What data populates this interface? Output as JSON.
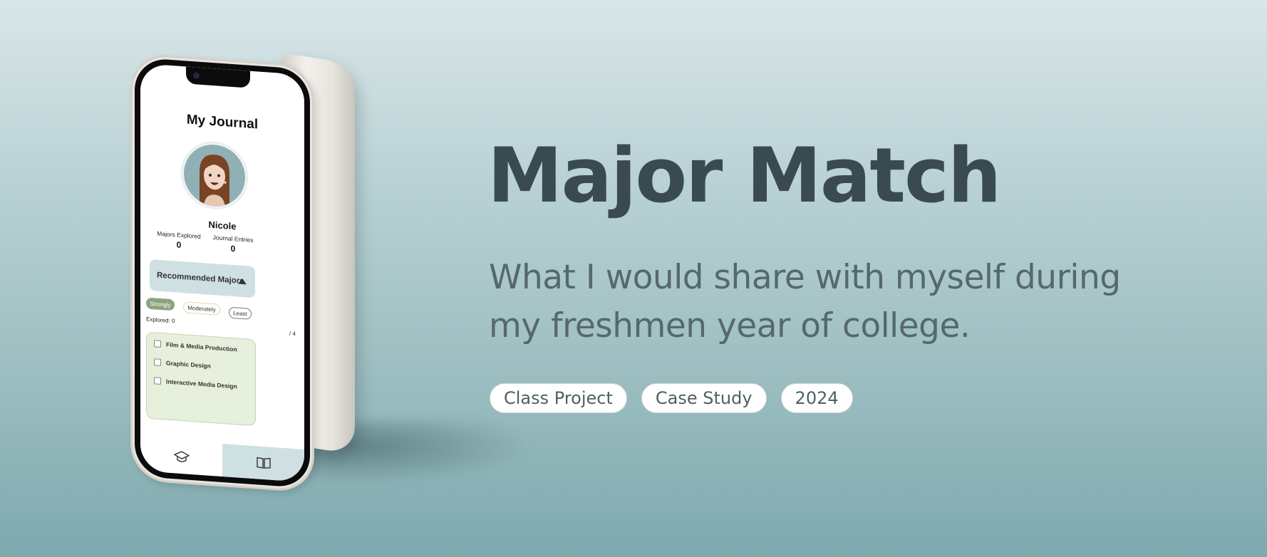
{
  "hero": {
    "title": "Major Match",
    "subtitle": "What I would share with myself during my freshmen year of college.",
    "tags": [
      "Class Project",
      "Case Study",
      "2024"
    ]
  },
  "phone": {
    "screen_title": "My Journal",
    "user_name": "Nicole",
    "stats": [
      {
        "label": "Majors Explored",
        "value": "0"
      },
      {
        "label": "Journal Entries",
        "value": "0"
      }
    ],
    "recommended_label": "Recommended Majors",
    "filters": [
      "Strongly",
      "Moderately",
      "Least"
    ],
    "explored_text": "Explored: 0",
    "count_text": "/ 4",
    "majors": [
      "Film & Media Production",
      "Graphic Design",
      "Interactive Media Design"
    ],
    "tab_icons": [
      "graduation-cap-icon",
      "book-icon"
    ]
  },
  "colors": {
    "title": "#3a4b50",
    "subtitle": "#56686d",
    "strong_pill": "#8aa57e",
    "recommended_bg": "#cfe0e2",
    "majors_bg": "#e6f0dc"
  }
}
